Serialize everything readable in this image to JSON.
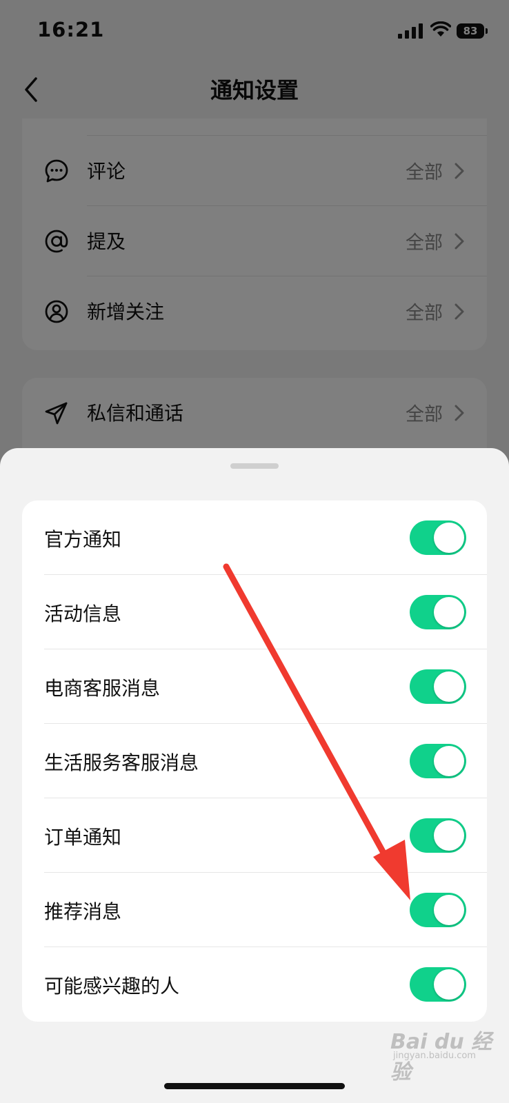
{
  "status_bar": {
    "time": "16:21",
    "battery": "83"
  },
  "header": {
    "title": "通知设置"
  },
  "background_list": {
    "card1": [
      {
        "icon": "comment-icon",
        "label": "评论",
        "value": "全部"
      },
      {
        "icon": "at-mention-icon",
        "label": "提及",
        "value": "全部"
      },
      {
        "icon": "user-circle-icon",
        "label": "新增关注",
        "value": "全部"
      }
    ],
    "card2": [
      {
        "icon": "send-icon",
        "label": "私信和通话",
        "value": "全部"
      }
    ]
  },
  "sheet": {
    "items": [
      {
        "label": "官方通知",
        "enabled": true
      },
      {
        "label": "活动信息",
        "enabled": true
      },
      {
        "label": "电商客服消息",
        "enabled": true
      },
      {
        "label": "生活服务客服消息",
        "enabled": true
      },
      {
        "label": "订单通知",
        "enabled": true
      },
      {
        "label": "推荐消息",
        "enabled": true
      },
      {
        "label": "可能感兴趣的人",
        "enabled": true
      }
    ]
  },
  "colors": {
    "toggle_on": "#10d18b",
    "annotation_arrow": "#f03a2f"
  },
  "watermark": {
    "text": "Bai du 经验",
    "sub": "jingyan.baidu.com"
  }
}
